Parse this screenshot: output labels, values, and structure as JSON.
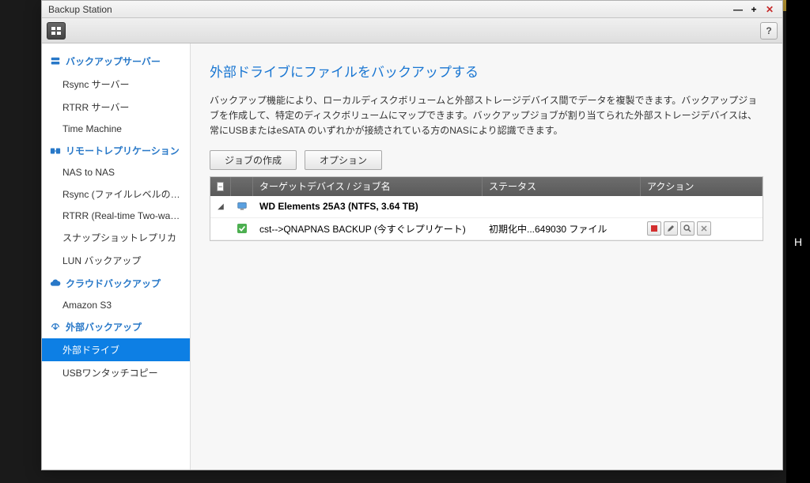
{
  "window": {
    "title": "Backup Station"
  },
  "toolbar": {
    "help": "?"
  },
  "sidebar": {
    "sections": [
      {
        "label": "バックアップサーバー",
        "icon": "server",
        "items": [
          {
            "label": "Rsync サーバー"
          },
          {
            "label": "RTRR サーバー"
          },
          {
            "label": "Time Machine"
          }
        ]
      },
      {
        "label": "リモートレプリケーション",
        "icon": "replication",
        "items": [
          {
            "label": "NAS to NAS"
          },
          {
            "label": "Rsync (ファイルレベルのバック..."
          },
          {
            "label": "RTRR (Real-time Two-way Folde..."
          },
          {
            "label": "スナップショットレプリカ"
          },
          {
            "label": "LUN バックアップ"
          }
        ]
      },
      {
        "label": "クラウドバックアップ",
        "icon": "cloud",
        "items": [
          {
            "label": "Amazon S3"
          }
        ]
      },
      {
        "label": "外部バックアップ",
        "icon": "external",
        "items": [
          {
            "label": "外部ドライブ",
            "selected": true
          },
          {
            "label": "USBワンタッチコピー"
          }
        ]
      }
    ]
  },
  "main": {
    "title": "外部ドライブにファイルをバックアップする",
    "description": "バックアップ機能により、ローカルディスクボリュームと外部ストレージデバイス間でデータを複製できます。バックアップジョブを作成して、特定のディスクボリュームにマップできます。バックアップジョブが割り当てられた外部ストレージデバイスは、常にUSBまたはeSATA のいずれかが接続されている方のNASにより認識できます。",
    "buttons": {
      "create_job": "ジョブの作成",
      "options": "オプション"
    },
    "grid": {
      "headers": {
        "name": "ターゲットデバイス / ジョブ名",
        "status": "ステータス",
        "action": "アクション"
      },
      "device_row": {
        "name": "WD Elements 25A3 (NTFS, 3.64 TB)"
      },
      "job_row": {
        "name": "cst-->QNAPNAS BACKUP (今すぐレプリケート)",
        "status": "初期化中...649030 ファイル"
      }
    }
  },
  "right_strip": {
    "letter": "H"
  }
}
